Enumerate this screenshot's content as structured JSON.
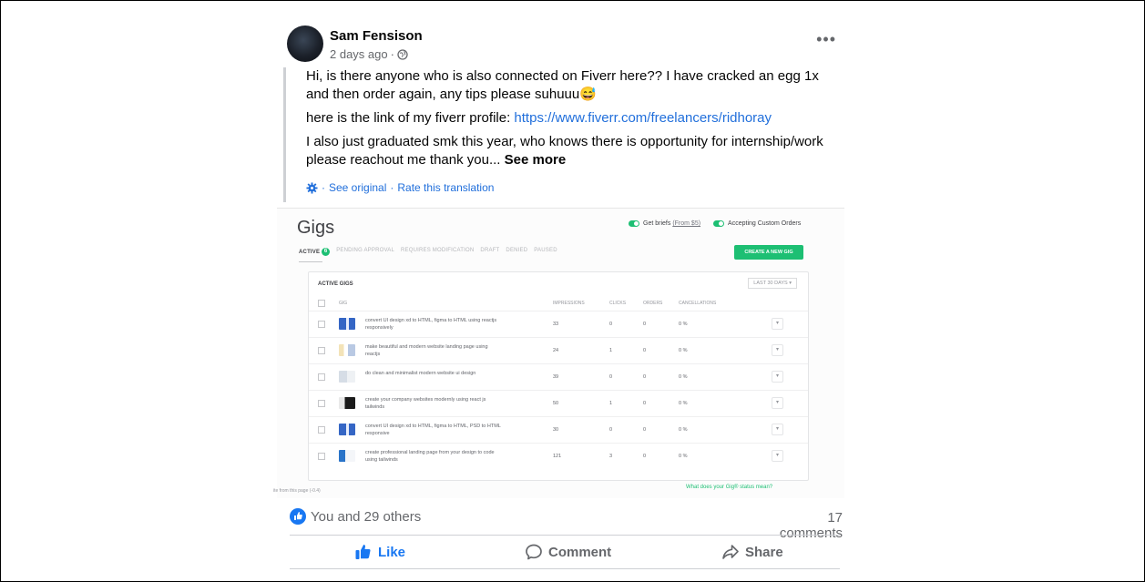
{
  "post": {
    "author": "Sam Fensison",
    "time": "2 days ago",
    "meta_separator": "·",
    "paragraphs": {
      "p1": "Hi, is there anyone who is also connected on Fiverr here?? I have cracked an egg 1x and then order again, any tips please suhuuu😅",
      "p2_prefix": "here is the link of my fiverr profile: ",
      "p2_link": "https://www.fiverr.com/freelancers/ridhoray",
      "p3": "I also just graduated smk this year, who knows there is opportunity for internship/work please reachout me thank you...",
      "see_more": "See more"
    },
    "translation": {
      "prefix": "·",
      "see_original": "See original",
      "separator": "·",
      "rate": "Rate this translation"
    }
  },
  "screenshot": {
    "title": "Gigs",
    "toggles": {
      "briefs_label": "Get briefs",
      "briefs_sub": "(From $5)",
      "custom_label": "Accepting Custom Orders"
    },
    "tabs": {
      "active": "ACTIVE",
      "active_count": "6",
      "pending": "PENDING APPROVAL",
      "requires_mod": "REQUIRES MODIFICATION",
      "draft": "DRAFT",
      "denied": "DENIED",
      "paused": "PAUSED"
    },
    "create_button": "CREATE A NEW GIG",
    "card_title": "ACTIVE GIGS",
    "range": "LAST 30 DAYS ▾",
    "columns": {
      "gig": "GIG",
      "impressions": "IMPRESSIONS",
      "clicks": "CLICKS",
      "orders": "ORDERS",
      "cancellations": "CANCELLATIONS"
    },
    "rows": [
      {
        "title": "convert UI design xd to HTML, figma to HTML using reactjs responsively",
        "impressions": "33",
        "clicks": "0",
        "orders": "0",
        "cancellations": "0 %"
      },
      {
        "title": "make beautiful and modern website landing page using reactjs",
        "impressions": "24",
        "clicks": "1",
        "orders": "0",
        "cancellations": "0 %"
      },
      {
        "title": "do clean and minimalist modern website ui design",
        "impressions": "39",
        "clicks": "0",
        "orders": "0",
        "cancellations": "0 %"
      },
      {
        "title": "create your company websites modernly using react js tailwinds",
        "impressions": "50",
        "clicks": "1",
        "orders": "0",
        "cancellations": "0 %"
      },
      {
        "title": "convert UI design xd to HTML, figma to HTML, PSD to HTML responsive",
        "impressions": "30",
        "clicks": "0",
        "orders": "0",
        "cancellations": "0 %"
      },
      {
        "title": "create professional landing page from your design to code using tailwinds",
        "impressions": "121",
        "clicks": "3",
        "orders": "0",
        "cancellations": "0 %"
      }
    ],
    "row_menu": "▾",
    "status_link": "What does your Gig® status mean?",
    "faded_note": "ite from this page (-0.4)",
    "colors": {
      "fiverr_green": "#1dbf73"
    }
  },
  "footer": {
    "reactions": "You and 29 others",
    "comments": "17 comments",
    "like": "Like",
    "comment": "Comment",
    "share": "Share",
    "colors": {
      "facebook_blue": "#1877f2"
    }
  },
  "icons": {
    "globe": "globe-icon",
    "more": "more-options-icon",
    "cog": "cog-icon",
    "like_badge": "like-badge-icon",
    "like": "thumbs-up-icon",
    "comment": "comment-icon",
    "share": "share-icon"
  }
}
